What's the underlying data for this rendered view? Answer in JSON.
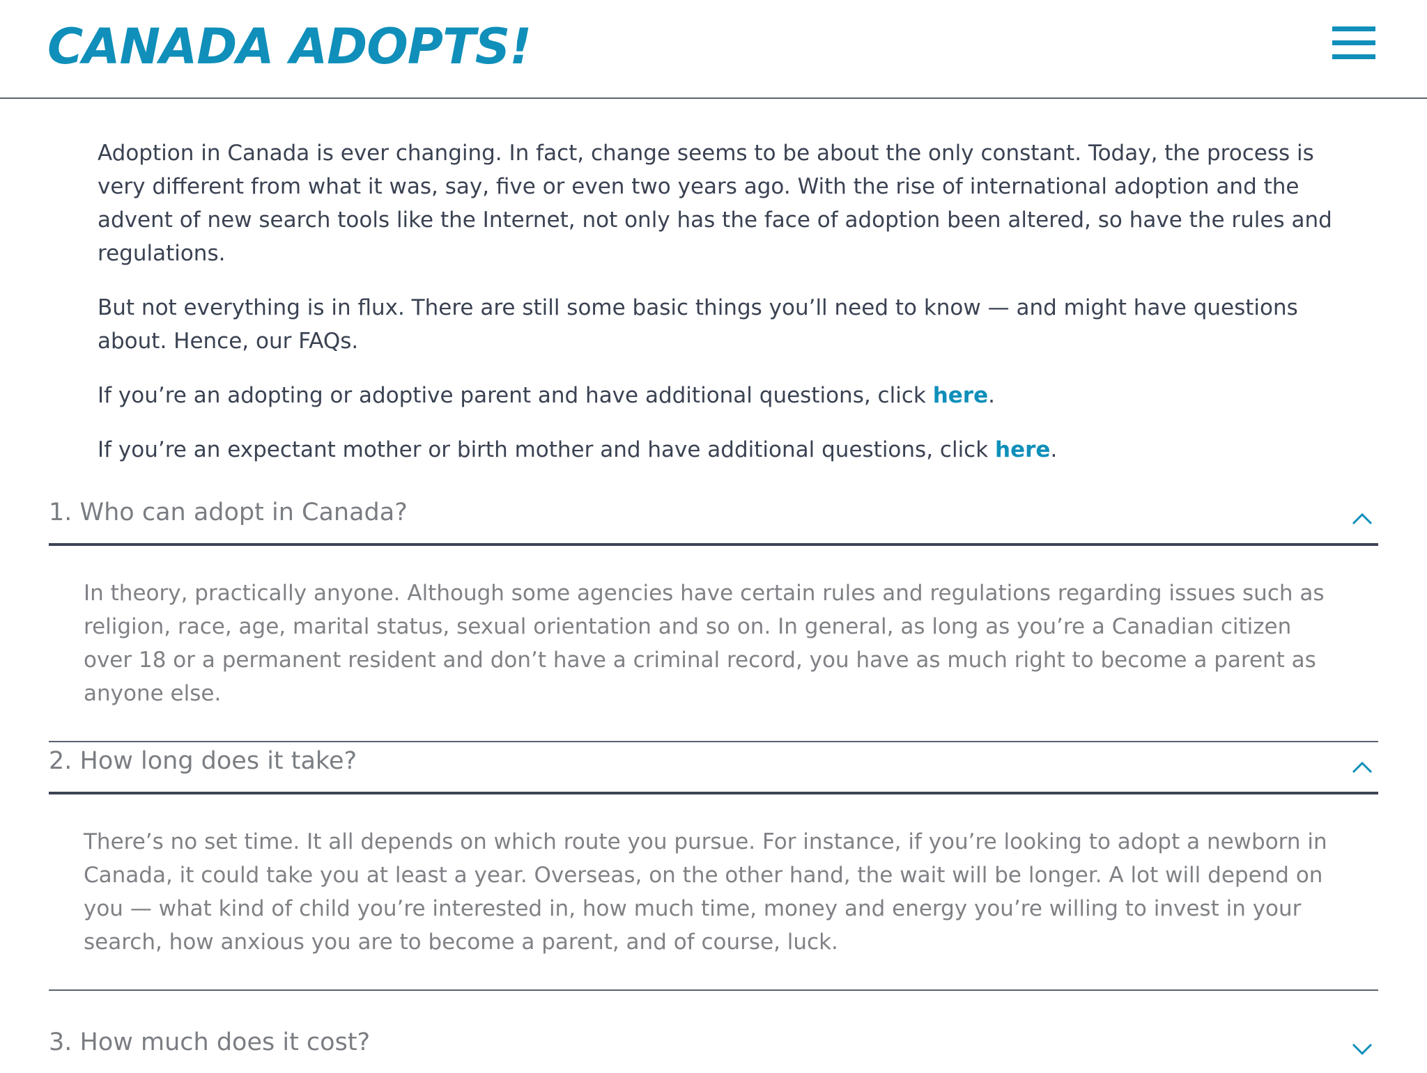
{
  "header": {
    "logo": "CANADA ADOPTS!",
    "menu_icon": "hamburger-icon"
  },
  "intro": {
    "p1": "Adoption in Canada is ever changing. In fact, change seems to be about the only constant. Today, the process is very different from what it was, say, five or even two years ago. With the rise of international adoption and the advent of new search tools like the Internet, not only has the face of adoption been altered, so have the rules and regulations.",
    "p2": "But not everything is in flux. There are still some basic things you’ll need to know — and might have questions about. Hence, our FAQs.",
    "p3_prefix": "If you’re an adopting or adoptive parent and have additional questions, click ",
    "p3_link": "here",
    "p3_suffix": ".",
    "p4_prefix": "If you’re an expectant mother or birth mother and have additional questions, click ",
    "p4_link": "here",
    "p4_suffix": ".",
    "link_color": "#0f8fb9"
  },
  "faqs": [
    {
      "question": "1. Who can adopt in Canada?",
      "answer": "In theory, practically anyone. Although some agencies have certain rules and regulations regarding issues such as religion, race, age, marital status, sexual orientation and so on. In general, as long as you’re a Canadian citizen over 18 or a permanent resident and don’t have a criminal record, you have as much right to become a parent as anyone else.",
      "expanded": true
    },
    {
      "question": "2. How long does it take?",
      "answer": "There’s no set time. It all depends on which route you pursue. For instance, if you’re looking to adopt a newborn in Canada, it could take you at least a year. Overseas, on the other hand, the wait will be longer. A lot will depend on you — what kind of child you’re interested in, how much time, money and energy you’re willing to invest in your search, how anxious you are to become a parent, and of course, luck.",
      "expanded": true
    },
    {
      "question": "3. How much does it cost?",
      "answer": "",
      "expanded": false
    }
  ],
  "colors": {
    "brand": "#0f8fb9",
    "text": "#3a4252",
    "muted": "#7f8185",
    "rule": "#3e4456"
  }
}
